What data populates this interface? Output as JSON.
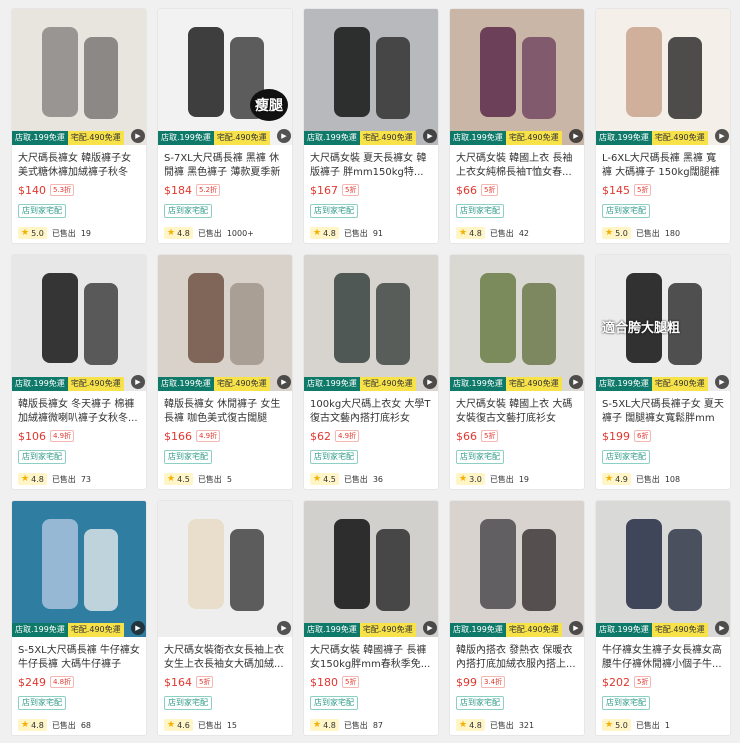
{
  "products": [
    {
      "title": "大尺碼長褲女 韓版褲子女美式糖休褲加絨褲子秋冬",
      "price": "$140",
      "discount": "5.3折",
      "tag": "店到家宅配",
      "rating": "5.0",
      "sold_label": "已售出",
      "sold": "19",
      "ship_a": "店取.199免運",
      "ship_b": "宅配.490免運",
      "colors": [
        "#e8e4de",
        "#8b8785",
        "#6d6a68"
      ],
      "overlay": ""
    },
    {
      "title": "S-7XL大尺碼長褲 黑褲 休閒褲 黑色褲子 薄款夏季新",
      "price": "$184",
      "discount": "5.2折",
      "tag": "店到家宅配",
      "rating": "4.8",
      "sold_label": "已售出",
      "sold": "1000+",
      "ship_a": "店取.199免運",
      "ship_b": "宅配.490免運",
      "colors": [
        "#f2f2f2",
        "#1f1f1f",
        "#2a2a2a"
      ],
      "overlay": "瘦腿"
    },
    {
      "title": "大尺碼女裝 夏天長褲女 韓版褲子 胖mm150kg特...",
      "price": "$167",
      "discount": "5折",
      "tag": "店到家宅配",
      "rating": "4.8",
      "sold_label": "已售出",
      "sold": "91",
      "ship_a": "店取.199免運",
      "ship_b": "宅配.490免運",
      "colors": [
        "#b7b9bd",
        "#151515",
        "#202020"
      ],
      "overlay": ""
    },
    {
      "title": "大尺碼女裝 韓國上衣 長袖上衣女純棉長袖T恤女春...",
      "price": "$66",
      "discount": "5折",
      "tag": "店到家宅配",
      "rating": "4.8",
      "sold_label": "已售出",
      "sold": "42",
      "ship_a": "店取.199免運",
      "ship_b": "宅配.490免運",
      "colors": [
        "#c9b6a6",
        "#5b2b4a",
        "#6a3b5a"
      ],
      "overlay": ""
    },
    {
      "title": "L-6XL大尺碼長褲 黑褲 寬褲 大碼褲子 150kg闊腿褲女...",
      "price": "$145",
      "discount": "5折",
      "tag": "店到家宅配",
      "rating": "5.0",
      "sold_label": "已售出",
      "sold": "180",
      "ship_a": "店取.199免運",
      "ship_b": "宅配.490免運",
      "colors": [
        "#f4efe9",
        "#caa58d",
        "#161616"
      ],
      "overlay": ""
    },
    {
      "title": "韓版長褲女 冬天褲子 棉褲加絨褲微喇叭褲子女秋冬...",
      "price": "$106",
      "discount": "4.9折",
      "tag": "店到家宅配",
      "rating": "4.8",
      "sold_label": "已售出",
      "sold": "73",
      "ship_a": "店取.199免運",
      "ship_b": "宅配.490免運",
      "colors": [
        "#e7e7e7",
        "#151515",
        "#2a2a2a"
      ],
      "overlay": ""
    },
    {
      "title": "韓版長褲女 休閒褲子 女生長褲 咖色美式復古闊腿褲...",
      "price": "$166",
      "discount": "4.9折",
      "tag": "店到家宅配",
      "rating": "4.5",
      "sold_label": "已售出",
      "sold": "5",
      "ship_a": "店取.199免運",
      "ship_b": "宅配.490免運",
      "colors": [
        "#d9d2cb",
        "#6e5345",
        "#9a8d82"
      ],
      "overlay": ""
    },
    {
      "title": "100kg大尺碼上衣女 大學T 復古文藝內搭打底衫女20...",
      "price": "$62",
      "discount": "4.9折",
      "tag": "店到家宅配",
      "rating": "4.5",
      "sold_label": "已售出",
      "sold": "36",
      "ship_a": "店取.199免運",
      "ship_b": "宅配.490免運",
      "colors": [
        "#d7d3cf",
        "#384240",
        "#2f3533"
      ],
      "overlay": ""
    },
    {
      "title": "大尺碼女裝 韓國上衣 大碼女裝復古文藝打底衫女20...",
      "price": "$66",
      "discount": "5折",
      "tag": "店到家宅配",
      "rating": "3.0",
      "sold_label": "已售出",
      "sold": "19",
      "ship_a": "店取.199免運",
      "ship_b": "宅配.490免運",
      "colors": [
        "#dad8d3",
        "#6b7e45",
        "#5d6e3b"
      ],
      "overlay": ""
    },
    {
      "title": "S-5XL大尺碼長褲子女 夏天褲子 闊腿褲女寬鬆胖mm顯...",
      "price": "$199",
      "discount": "6折",
      "tag": "店到家宅配",
      "rating": "4.9",
      "sold_label": "已售出",
      "sold": "108",
      "ship_a": "店取.199免運",
      "ship_b": "宅配.490免運",
      "colors": [
        "#ececec",
        "#111111",
        "#1b1b1b"
      ],
      "overlay": "適合胯大腿粗"
    },
    {
      "title": "S-5XL大尺碼長褲 牛仔褲女 牛仔長褲 大碼牛仔褲子寬...",
      "price": "$249",
      "discount": "4.8折",
      "tag": "店到家宅配",
      "rating": "4.8",
      "sold_label": "已售出",
      "sold": "68",
      "ship_a": "店取.199免運",
      "ship_b": "宅配.490免運",
      "colors": [
        "#2f7ea1",
        "#a9c2dd",
        "#f0f0f0"
      ],
      "overlay": ""
    },
    {
      "title": "大尺碼女裝衛衣女長袖上衣女生上衣長袖女大碼加絨...",
      "price": "$164",
      "discount": "5折",
      "tag": "店到家宅配",
      "rating": "4.6",
      "sold_label": "已售出",
      "sold": "15",
      "ship_a": "",
      "ship_b": "",
      "colors": [
        "#eeeeee",
        "#e8dac4",
        "#2b2b2b"
      ],
      "overlay": ""
    },
    {
      "title": "大尺碼女裝 韓國褲子 長褲女150kg胖mm春秋季免...",
      "price": "$180",
      "discount": "5折",
      "tag": "店到家宅配",
      "rating": "4.8",
      "sold_label": "已售出",
      "sold": "87",
      "ship_a": "店取.199免運",
      "ship_b": "宅配.490免運",
      "colors": [
        "#d2d0cd",
        "#101010",
        "#1a1a1a"
      ],
      "overlay": ""
    },
    {
      "title": "韓版內搭衣 發熱衣 保暖衣 內搭打底加絨衣服內搭上...",
      "price": "$99",
      "discount": "3.4折",
      "tag": "店到家宅配",
      "rating": "4.8",
      "sold_label": "已售出",
      "sold": "321",
      "ship_a": "店取.199免運",
      "ship_b": "宅配.490免運",
      "colors": [
        "#d8d3cf",
        "#4e4a50",
        "#2a2326"
      ],
      "overlay": ""
    },
    {
      "title": "牛仔褲女生褲子女長褲女高腰牛仔褲休閒褲小個子牛...",
      "price": "$202",
      "discount": "5折",
      "tag": "店到家宅配",
      "rating": "5.0",
      "sold_label": "已售出",
      "sold": "1",
      "ship_a": "店取.199免運",
      "ship_b": "宅配.490免運",
      "colors": [
        "#d9d9d7",
        "#232c44",
        "#1a2236"
      ],
      "overlay": ""
    }
  ]
}
